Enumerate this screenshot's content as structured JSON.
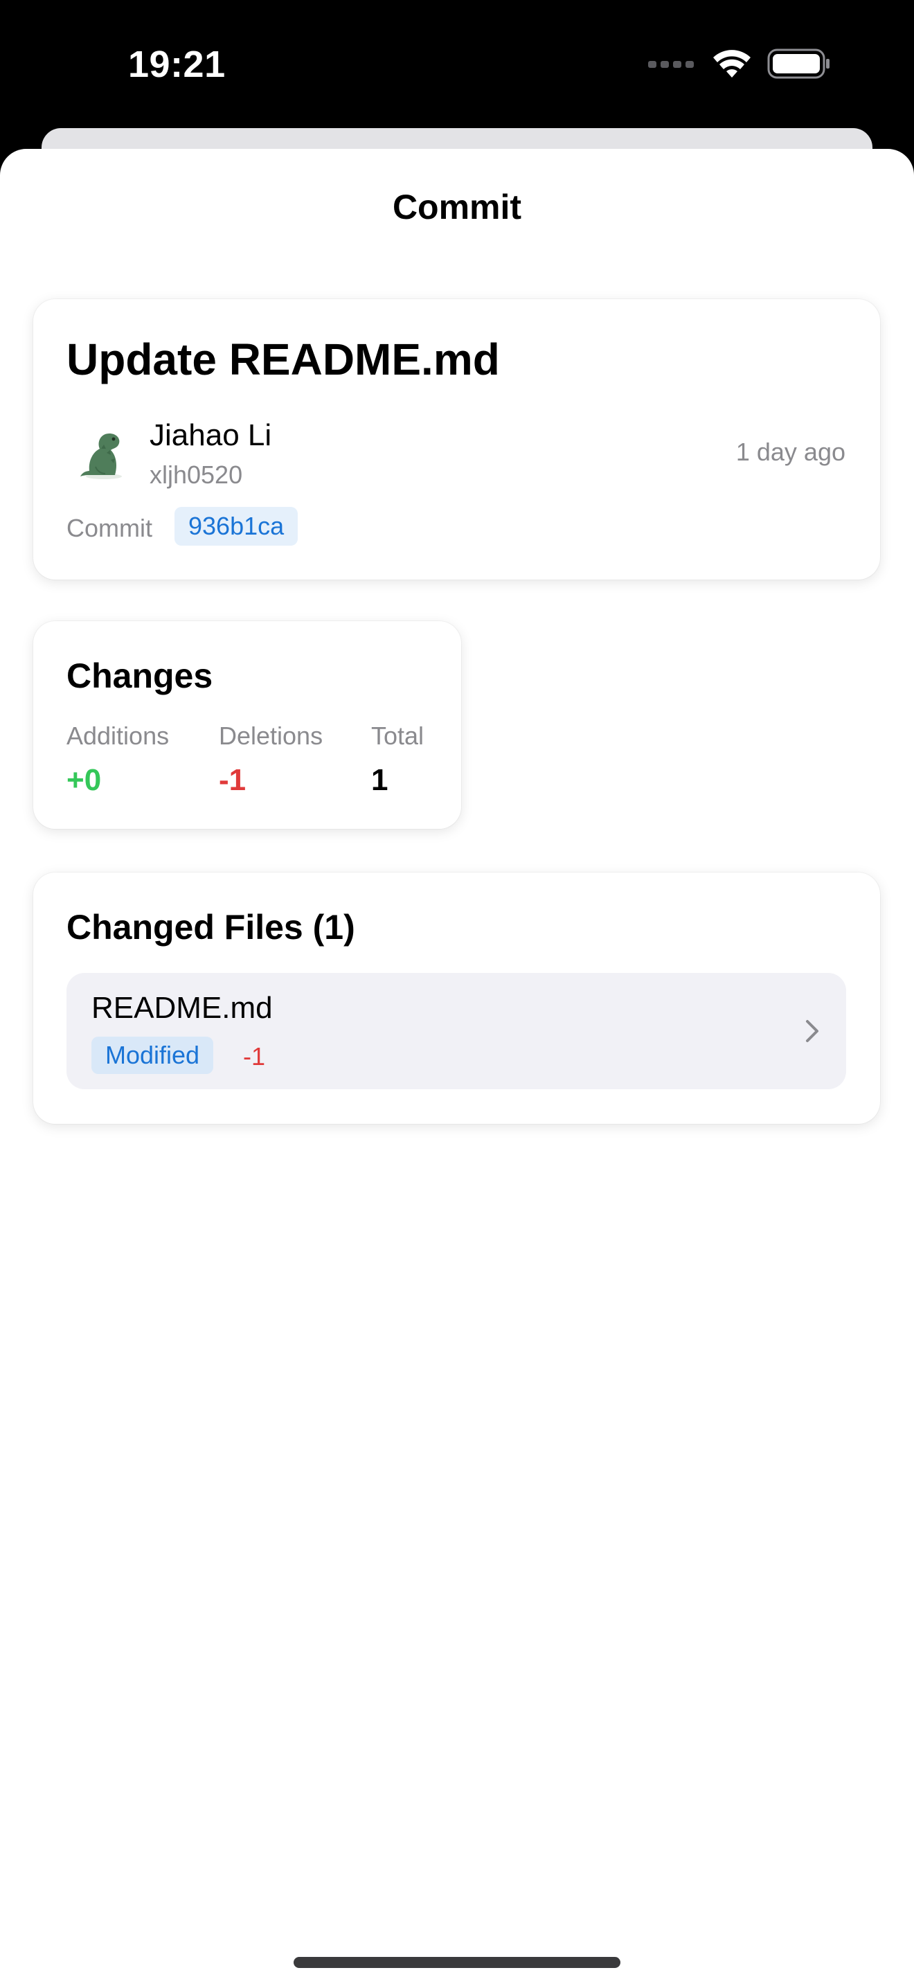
{
  "status_bar": {
    "time": "19:21"
  },
  "nav": {
    "title": "Commit"
  },
  "commit": {
    "title": "Update README.md",
    "author_name": "Jiahao Li",
    "author_login": "xljh0520",
    "relative_time": "1 day ago",
    "commit_label": "Commit",
    "sha": "936b1ca"
  },
  "changes": {
    "title": "Changes",
    "additions_label": "Additions",
    "additions_value": "+0",
    "deletions_label": "Deletions",
    "deletions_value": "-1",
    "total_label": "Total",
    "total_value": "1"
  },
  "changed_files": {
    "title": "Changed Files (1)",
    "files": [
      {
        "name": "README.md",
        "status": "Modified",
        "deletions": "-1"
      }
    ]
  },
  "colors": {
    "addition_green": "#34c759",
    "deletion_red": "#e03a3a",
    "link_blue": "#1a74d6",
    "secondary_text": "#8a8a8e"
  },
  "icons": [
    "wifi-icon",
    "battery-icon",
    "cellular-signal-icon",
    "chevron-right-icon",
    "avatar-dinosaur"
  ]
}
